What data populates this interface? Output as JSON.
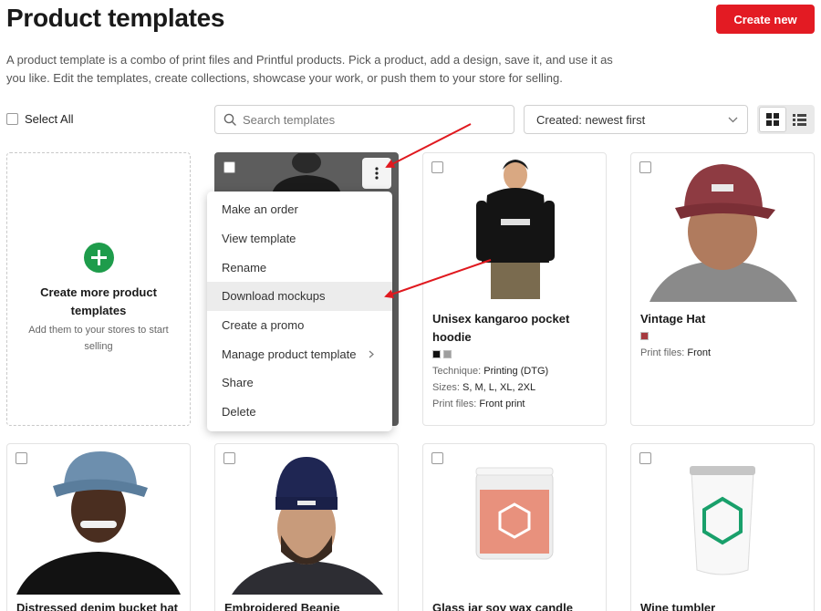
{
  "header": {
    "title": "Product templates",
    "create_new": "Create new",
    "description": "A product template is a combo of print files and Printful products. Pick a product, add a design, save it, and use it as you like. Edit the templates, create collections, showcase your work, or push them to your store for selling."
  },
  "toolbar": {
    "select_all": "Select All",
    "search_placeholder": "Search templates",
    "sort_value": "Created: newest first",
    "view_modes": [
      "grid-view-icon",
      "list-view-icon"
    ],
    "active_view": "grid"
  },
  "create_more": {
    "title": "Create more product templates",
    "subtitle": "Add them to your stores to start selling"
  },
  "context_menu": {
    "items": [
      "Make an order",
      "View template",
      "Rename",
      "Download mockups",
      "Create a promo",
      "Manage product template",
      "Share",
      "Delete"
    ],
    "highlighted": "Download mockups"
  },
  "products": [
    {
      "title": "Unisex kangaroo pocket hoodie",
      "swatch_colors": [
        "#111111",
        "#9e9e9e"
      ],
      "technique_label": "Technique:",
      "technique": "Printing (DTG)",
      "sizes_label": "Sizes:",
      "sizes": "S, M, L, XL, 2XL",
      "print_label": "Print files:",
      "print_files": "Front print"
    },
    {
      "title": "Vintage Hat",
      "swatch_colors": [
        "#a63a3f"
      ],
      "print_label": "Print files:",
      "print_files": "Front"
    },
    {
      "title": "Distressed denim bucket hat"
    },
    {
      "title": "Embroidered Beanie"
    },
    {
      "title": "Glass jar soy wax candle"
    },
    {
      "title": "Wine tumbler"
    }
  ],
  "colors": {
    "accent": "#e31b23",
    "create_icon": "#1e9c4b",
    "annotation_arrow": "#e0191f"
  }
}
